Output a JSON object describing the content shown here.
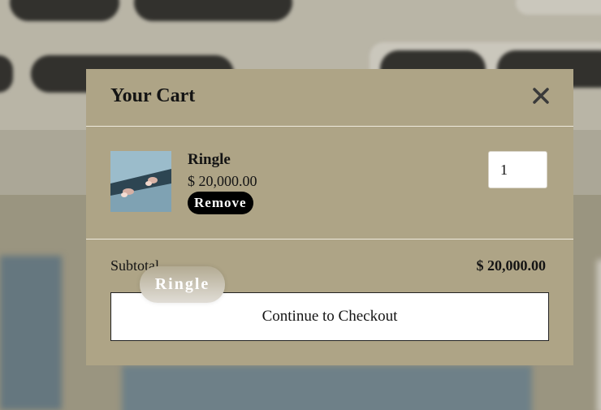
{
  "cart": {
    "title": "Your Cart",
    "items": [
      {
        "name": "Ringle",
        "price": "$ 20,000.00",
        "remove_label": "Remove",
        "quantity": "1"
      }
    ],
    "subtotal_label": "Subtotal",
    "subtotal_value": "$ 20,000.00",
    "checkout_label": "Continue to Checkout"
  },
  "tooltip": {
    "text": "Ringle"
  },
  "icons": {
    "close": "close-icon"
  },
  "colors": {
    "modal_bg": "#aea486",
    "button_dark": "#000000",
    "checkout_bg": "#ffffff"
  }
}
